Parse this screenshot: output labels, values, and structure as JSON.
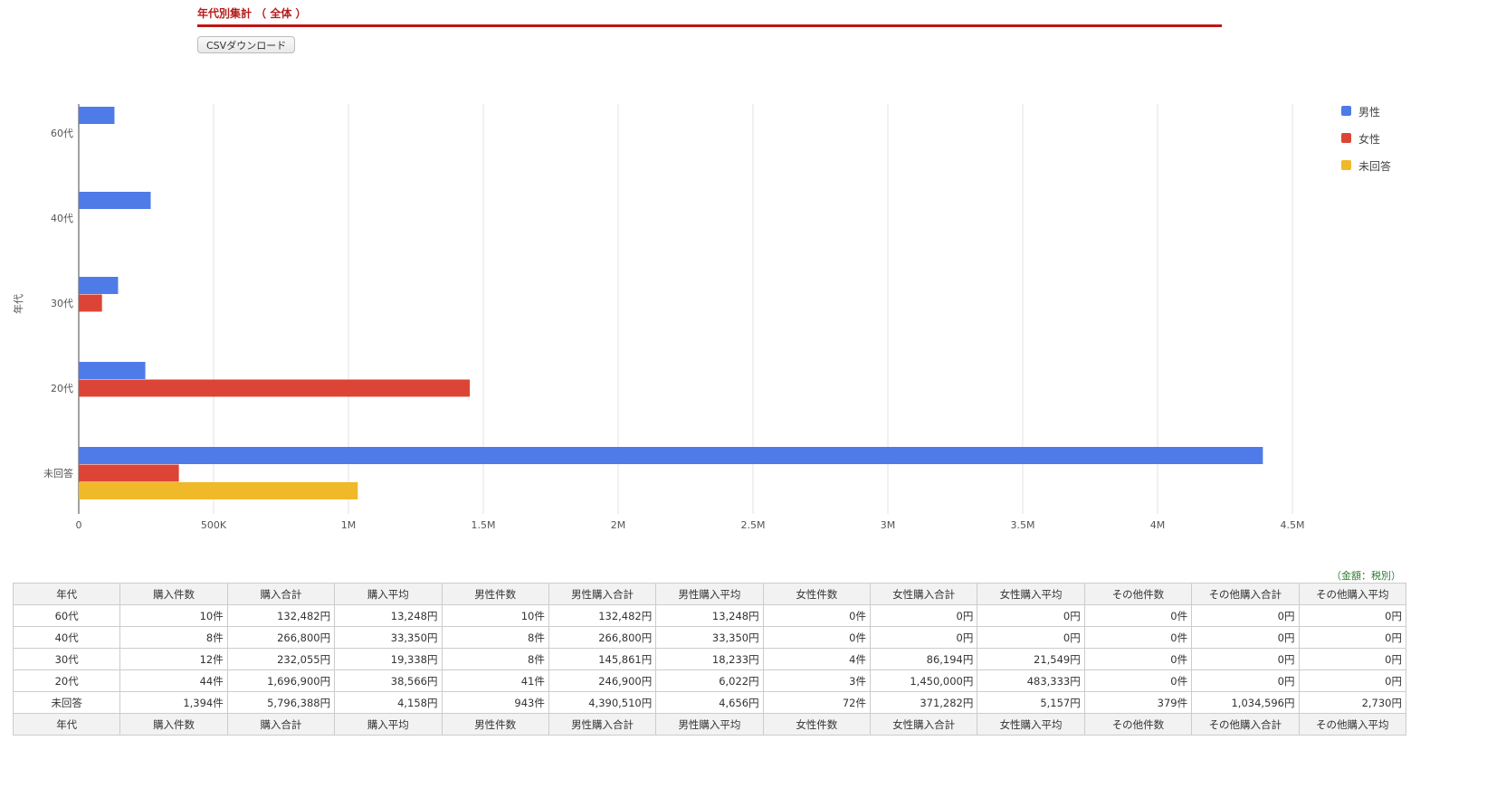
{
  "header": {
    "title": "年代別集計 （ 全体 ）",
    "csv_button": "CSVダウンロード"
  },
  "chart_data": {
    "type": "bar",
    "orientation": "horizontal",
    "categories": [
      "60代",
      "40代",
      "30代",
      "20代",
      "未回答"
    ],
    "series": [
      {
        "name": "男性",
        "color": "#4f7be8",
        "values": [
          132482,
          266800,
          145861,
          246900,
          4390510
        ]
      },
      {
        "name": "女性",
        "color": "#dc4535",
        "values": [
          0,
          0,
          86194,
          1450000,
          371282
        ]
      },
      {
        "name": "未回答",
        "color": "#f0b92a",
        "values": [
          0,
          0,
          0,
          0,
          1034596
        ]
      }
    ],
    "ylabel": "年代",
    "xlim": [
      0,
      4600000
    ],
    "xticks": [
      0,
      500000,
      1000000,
      1500000,
      2000000,
      2500000,
      3000000,
      3500000,
      4000000,
      4500000
    ],
    "xtick_labels": [
      "0",
      "500K",
      "1M",
      "1.5M",
      "2M",
      "2.5M",
      "3M",
      "3.5M",
      "4M",
      "4.5M"
    ],
    "grid": true,
    "legend": "right"
  },
  "table": {
    "note": "（金額：税別）",
    "headers": [
      "年代",
      "購入件数",
      "購入合計",
      "購入平均",
      "男性件数",
      "男性購入合計",
      "男性購入平均",
      "女性件数",
      "女性購入合計",
      "女性購入平均",
      "その他件数",
      "その他購入合計",
      "その他購入平均"
    ],
    "rows": [
      [
        "60代",
        "10件",
        "132,482円",
        "13,248円",
        "10件",
        "132,482円",
        "13,248円",
        "0件",
        "0円",
        "0円",
        "0件",
        "0円",
        "0円"
      ],
      [
        "40代",
        "8件",
        "266,800円",
        "33,350円",
        "8件",
        "266,800円",
        "33,350円",
        "0件",
        "0円",
        "0円",
        "0件",
        "0円",
        "0円"
      ],
      [
        "30代",
        "12件",
        "232,055円",
        "19,338円",
        "8件",
        "145,861円",
        "18,233円",
        "4件",
        "86,194円",
        "21,549円",
        "0件",
        "0円",
        "0円"
      ],
      [
        "20代",
        "44件",
        "1,696,900円",
        "38,566円",
        "41件",
        "246,900円",
        "6,022円",
        "3件",
        "1,450,000円",
        "483,333円",
        "0件",
        "0円",
        "0円"
      ],
      [
        "未回答",
        "1,394件",
        "5,796,388円",
        "4,158円",
        "943件",
        "4,390,510円",
        "4,656円",
        "72件",
        "371,282円",
        "5,157円",
        "379件",
        "1,034,596円",
        "2,730円"
      ]
    ]
  }
}
